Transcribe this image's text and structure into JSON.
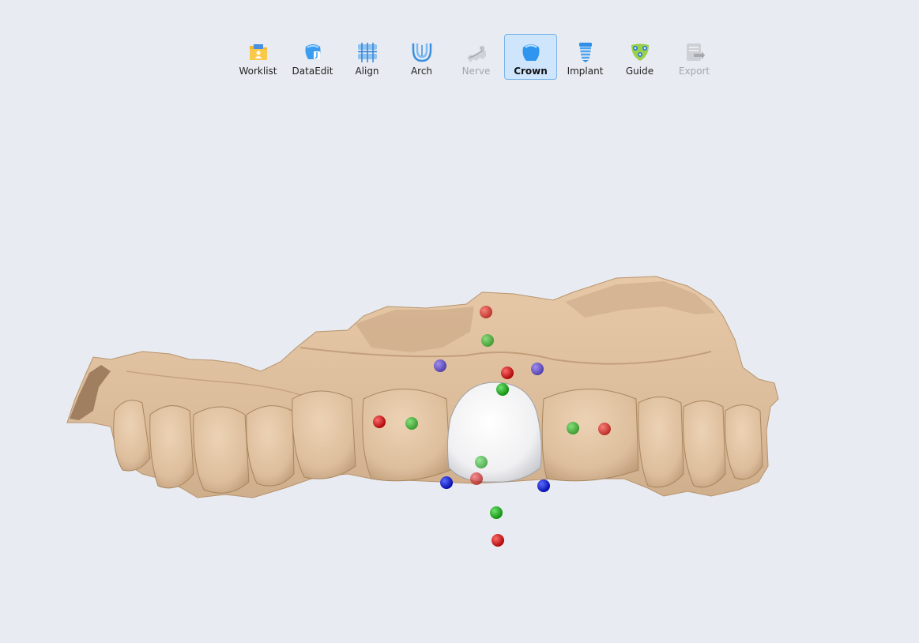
{
  "toolbar": {
    "items": [
      {
        "label": "Worklist",
        "icon": "worklist-icon",
        "state": "normal"
      },
      {
        "label": "DataEdit",
        "icon": "data-edit-icon",
        "state": "normal"
      },
      {
        "label": "Align",
        "icon": "align-icon",
        "state": "normal"
      },
      {
        "label": "Arch",
        "icon": "arch-icon",
        "state": "normal"
      },
      {
        "label": "Nerve",
        "icon": "nerve-icon",
        "state": "disabled"
      },
      {
        "label": "Crown",
        "icon": "crown-icon",
        "state": "active"
      },
      {
        "label": "Implant",
        "icon": "implant-icon",
        "state": "normal"
      },
      {
        "label": "Guide",
        "icon": "guide-icon",
        "state": "normal"
      },
      {
        "label": "Export",
        "icon": "export-icon",
        "state": "disabled"
      }
    ]
  },
  "viewport": {
    "model": "dental-arch-scan",
    "crown": "white-crown",
    "marker_colors": {
      "red": "#c80000",
      "green": "#1aa51a",
      "blue": "#0010cc",
      "purple": "#6a56c0"
    }
  },
  "colors": {
    "background": "#e8ebf1",
    "active_tool_bg": "#cfe5fb",
    "active_tool_border": "#79b3ea",
    "jaw": "#e0c2a2"
  }
}
